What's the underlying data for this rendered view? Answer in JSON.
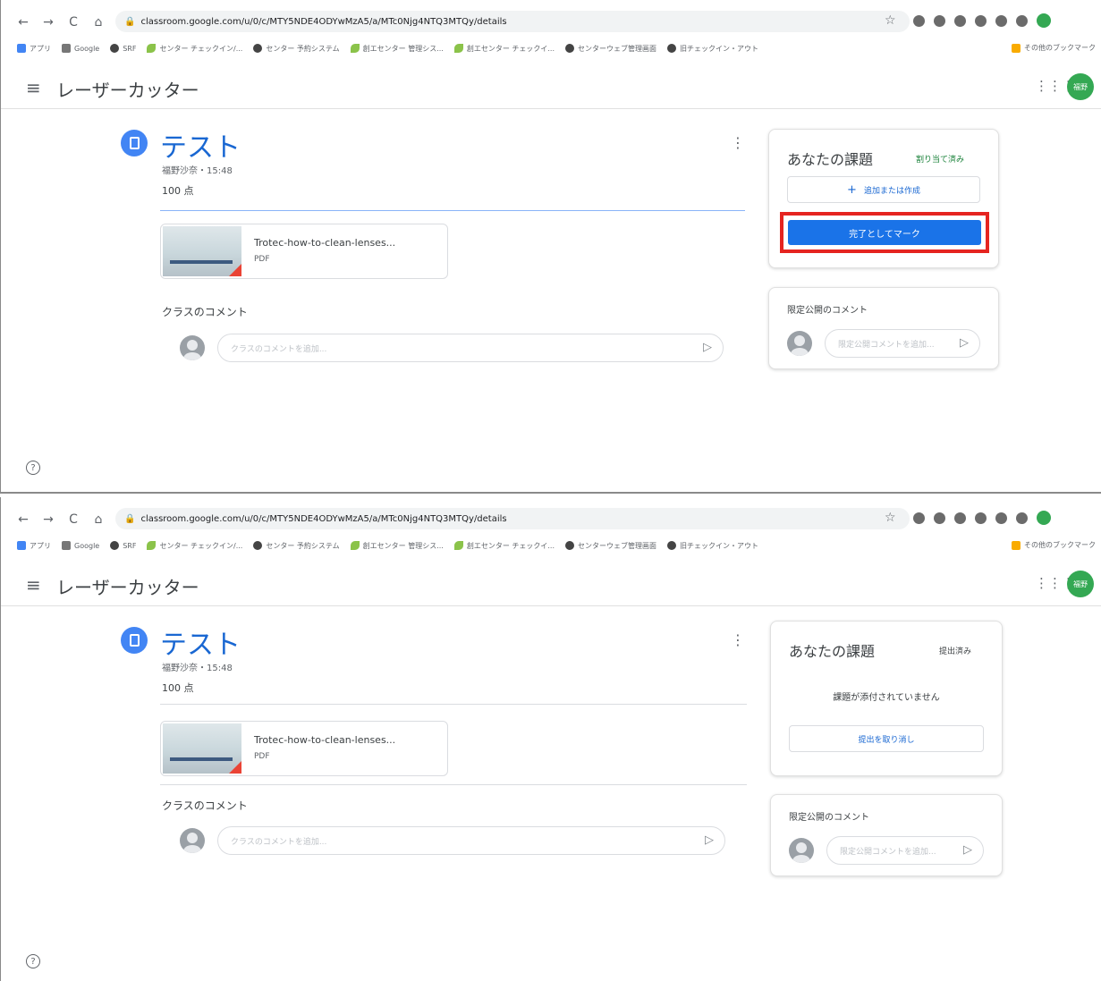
{
  "browser": {
    "back": "←",
    "forward": "→",
    "reload": "C",
    "home": "⌂",
    "lock": "🔒",
    "url": "classroom.google.com/u/0/c/MTY5NDE4ODYwMzA5/a/MTc0Njg4NTQ3MTQy/details",
    "star": "☆",
    "profile_text": "",
    "bookmarks": [
      {
        "icon": "apps",
        "label": "アプリ"
      },
      {
        "icon": "google",
        "label": "Google"
      },
      {
        "icon": "globe",
        "label": "SRF"
      },
      {
        "icon": "leaf",
        "label": "センター チェックイン/..."
      },
      {
        "icon": "globe",
        "label": "センター 予約システム"
      },
      {
        "icon": "leaf",
        "label": "創エセンター 管理シス..."
      },
      {
        "icon": "leaf",
        "label": "創エセンター チェックイ..."
      },
      {
        "icon": "globe",
        "label": "センターウェブ管理画面"
      },
      {
        "icon": "globe",
        "label": "旧チェックイン・アウト"
      }
    ],
    "other_bookmarks": "その他のブックマーク"
  },
  "app": {
    "title": "レーザーカッター",
    "menu_icon": "≡",
    "apps_icon": "⋮⋮⋮",
    "avatar_label": "福野"
  },
  "assignment": {
    "title": "テスト",
    "meta": "福野沙奈・15:48",
    "points": "100 点",
    "kebab": "⋮",
    "attachment": {
      "name": "Trotec-how-to-clean-lenses...",
      "type": "PDF"
    },
    "class_comments_label": "クラスのコメント",
    "class_comment_placeholder": "クラスのコメントを追加..."
  },
  "before": {
    "card_title": "あなたの課題",
    "status": "割り当て済み",
    "status_color": "#188038",
    "add_button": "追加または作成",
    "add_icon": "+",
    "mark_done_button": "完了としてマーク",
    "private_comments_title": "限定公開のコメント",
    "private_comment_placeholder": "限定公開コメントを追加..."
  },
  "after": {
    "card_title": "あなたの課題",
    "status": "提出済み",
    "status_color": "#3c4043",
    "empty_note": "課題が添付されていません",
    "unsubmit_button": "提出を取り消し",
    "private_comments_title": "限定公開のコメント",
    "private_comment_placeholder": "限定公開コメントを追加..."
  },
  "icons": {
    "send": "send-icon",
    "help": "?"
  }
}
